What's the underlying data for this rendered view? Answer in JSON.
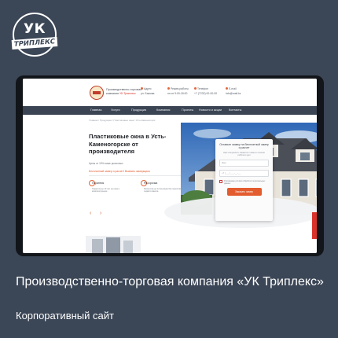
{
  "badge": {
    "line1": "УК",
    "line2": "ТРИПЛЕКС"
  },
  "site": {
    "company_line1": "Производственно-торговая",
    "company_line2": "компания",
    "company_brand": "УК Триплекс",
    "contacts": [
      {
        "label": "Адрес",
        "value": "ул. Бажова"
      },
      {
        "label": "Режим работы",
        "value": "пн-пт 9:00-18:00"
      },
      {
        "label": "Телефон",
        "value": "+7 (7232) 00-00-00"
      },
      {
        "label": "E-mail",
        "value": "info@mail.kz"
      }
    ],
    "nav": [
      "Главная",
      "Услуги",
      "Продукция",
      "Компания",
      "Проекты",
      "Новости и акции",
      "Контакты"
    ],
    "breadcrumb": "Главная / Продукция / Пластиковые окна / Усть-Каменогорск",
    "hero_title": "Пластиковые окна в Усть-Каменогорске от производителя",
    "hero_sub": "Цены от 10% ниже рыночных",
    "hero_discount": "Бесплатный замер и расчет! Вызвать замерщика",
    "cards": [
      {
        "title": "Гарантия",
        "text": "Гарантия до 10 лет на окна и комплектующие"
      },
      {
        "title": "Рассрочка",
        "text": "Рассрочка до 12 месяцев без переплат и первого взноса"
      }
    ],
    "form": {
      "title": "Оставьте заявку на бесплатный замер и расчет",
      "note": "Наш специалист свяжется с вами в течение рабочего дня",
      "name_placeholder": "Имя",
      "phone_placeholder": "+7 (___) ___-__-__",
      "consent": "Я принимаю условия обработки персональных данных",
      "button": "Заказать замер"
    }
  },
  "caption": {
    "title": "Производственно-торговая компания «УК Триплекс»",
    "subtitle": "Корпоративный сайт"
  },
  "colors": {
    "background": "#3b4656",
    "accent": "#e35c2f",
    "nav": "#3a4453",
    "brand_red": "#d9332c"
  }
}
